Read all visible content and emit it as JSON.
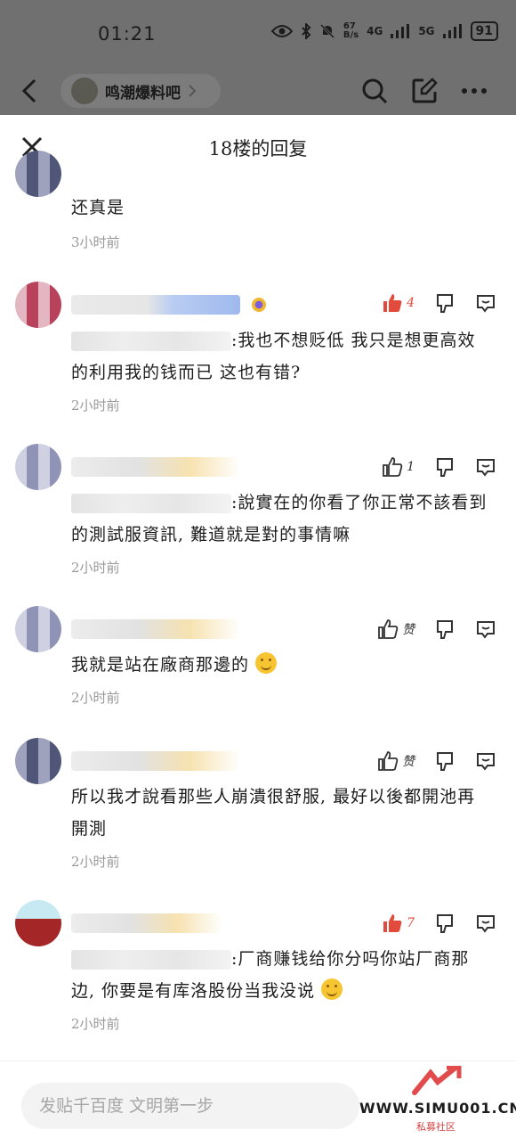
{
  "status_bar": {
    "time": "01:21",
    "net_speed": "67\nB/s",
    "sig1": "4G",
    "sig2": "5G",
    "battery": "91"
  },
  "nav": {
    "forum_name": "鸣潮爆料吧"
  },
  "sheet": {
    "title": "18楼的回复"
  },
  "replies": [
    {
      "text": "还真是",
      "time": "3小时前",
      "likes": "",
      "avatar": "dark"
    },
    {
      "text": ":我也不想贬低 我只是想更高效的利用我的钱而已 这也有错?",
      "time": "2小时前",
      "likes": "4",
      "avatar": "red"
    },
    {
      "text": ":說實在的你看了你正常不該看到的測試服資訊, 難道就是對的事情嘛",
      "time": "2小时前",
      "likes": "1",
      "avatar": "blue"
    },
    {
      "text": "我就是站在廠商那邊的",
      "time": "2小时前",
      "likes": "赞",
      "avatar": "blue"
    },
    {
      "text": "所以我才說看那些人崩潰很舒服, 最好以後都開池再開測",
      "time": "2小时前",
      "likes": "赞",
      "avatar": "dark"
    },
    {
      "text": ":厂商赚钱给你分吗你站厂商那边, 你要是有库洛股份当我没说",
      "time": "2小时前",
      "likes": "7",
      "avatar": "teal"
    }
  ],
  "bottom": {
    "placeholder": "发贴千百度 文明第一步"
  },
  "watermark": {
    "url": "WWW.SIMU001.CN",
    "sub": "私募社区"
  },
  "colors": {
    "accent_red": "#e24a3b",
    "overlay": "#707070"
  }
}
